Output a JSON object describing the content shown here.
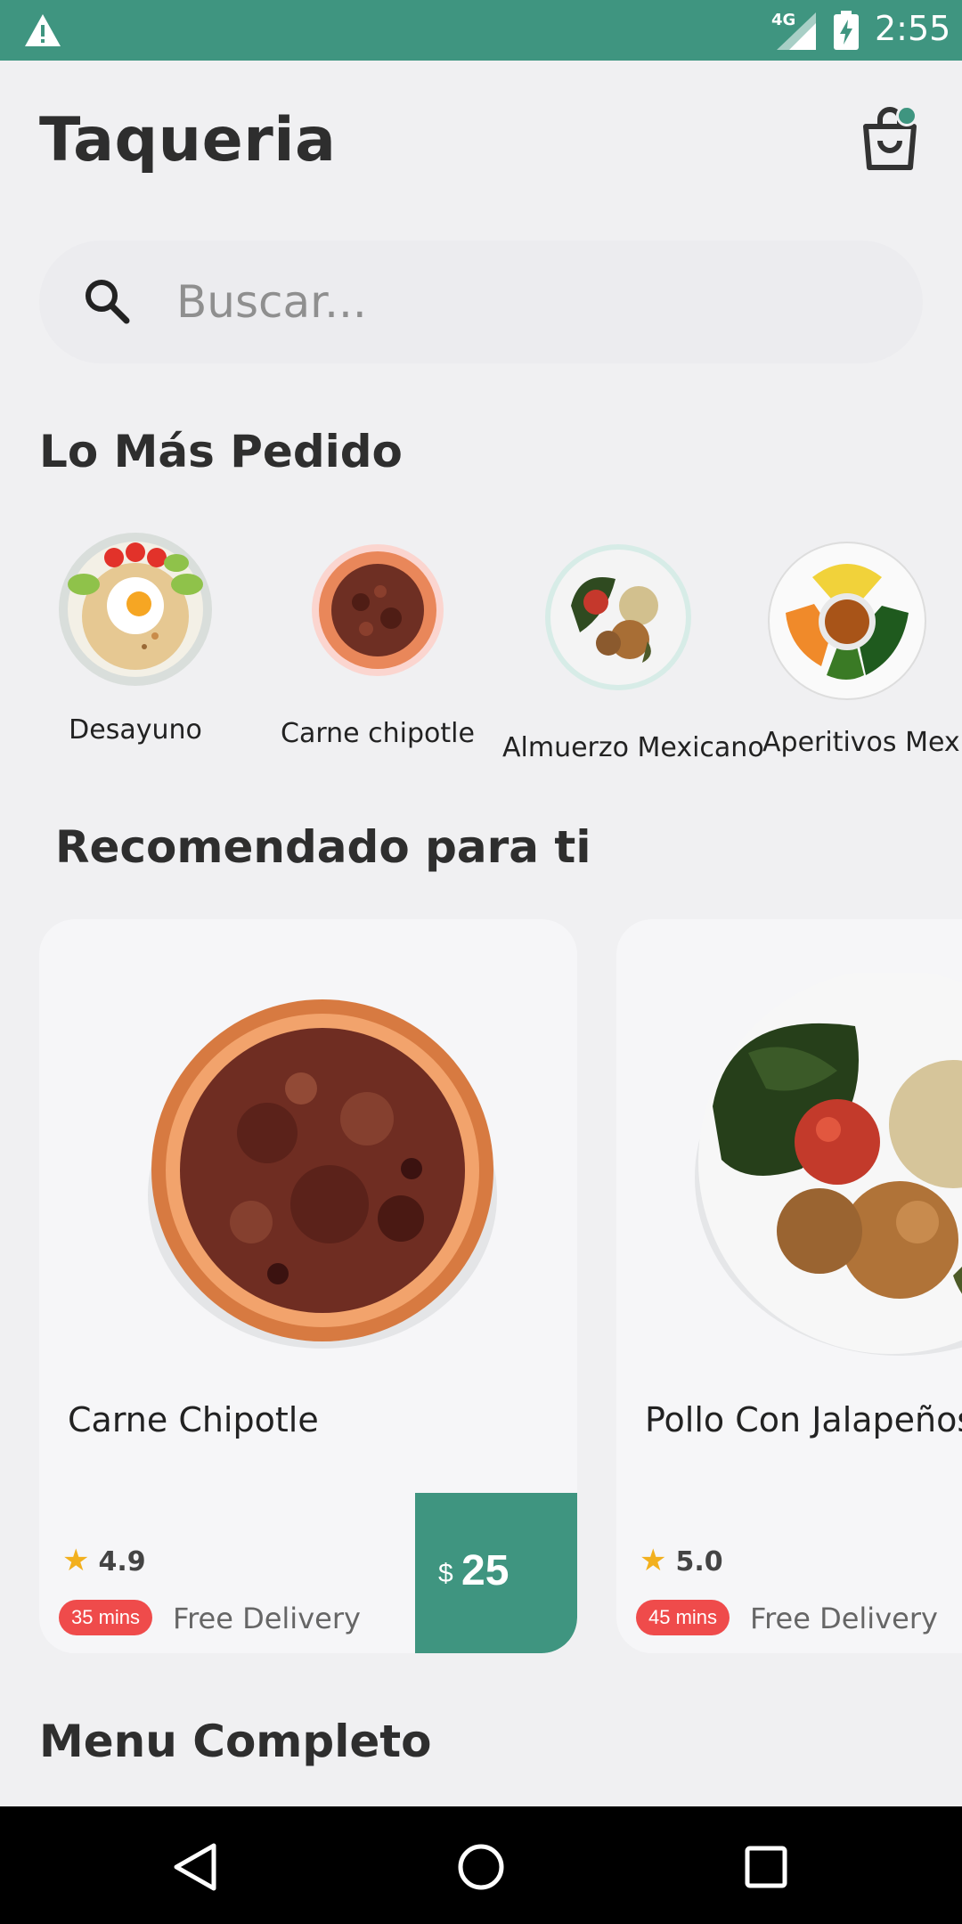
{
  "status_bar": {
    "network": "4G",
    "time": "2:55"
  },
  "header": {
    "title": "Taqueria"
  },
  "search": {
    "placeholder": "Buscar..."
  },
  "popular": {
    "title": "Lo Más Pedido",
    "items": [
      {
        "label": "Desayuno"
      },
      {
        "label": "Carne chipotle"
      },
      {
        "label": "Almuerzo Mexicano"
      },
      {
        "label": "Aperitivos Mexican"
      }
    ]
  },
  "recommended": {
    "title": "Recomendado para ti",
    "cards": [
      {
        "name": "Carne Chipotle",
        "rating": "4.9",
        "time": "35 mins",
        "delivery": "Free Delivery",
        "currency": "$",
        "price": "25"
      },
      {
        "name": "Pollo Con Jalapeños",
        "rating": "5.0",
        "time": "45 mins",
        "delivery": "Free Delivery"
      }
    ]
  },
  "menu": {
    "title": "Menu Completo"
  },
  "colors": {
    "accent": "#3f9580",
    "badge": "#ef4b4b",
    "star": "#f2b01e"
  }
}
